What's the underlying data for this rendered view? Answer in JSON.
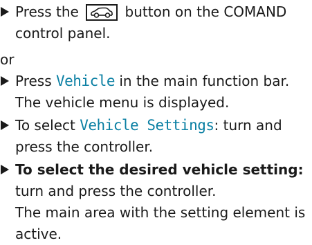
{
  "step1": {
    "press_prefix": "Press the",
    "button_suffix": "button on the COMAND",
    "continuation": "control panel.",
    "button_icon": "car-icon"
  },
  "or_label": "or",
  "step2": {
    "prefix": "Press",
    "ui_term": "Vehicle",
    "suffix": "in the main function bar.",
    "result": "The vehicle menu is displayed."
  },
  "step3": {
    "prefix": "To select",
    "ui_term": "Vehicle Settings",
    "suffix": ": turn and",
    "continuation": "press the controller."
  },
  "step4": {
    "bold_text": "To select the desired vehicle setting:",
    "line2": "turn and press the controller.",
    "line3": "The main area with the setting element is",
    "line4": "active."
  },
  "colors": {
    "ui_term": "#0a7fa3",
    "text": "#1a1a1a"
  }
}
